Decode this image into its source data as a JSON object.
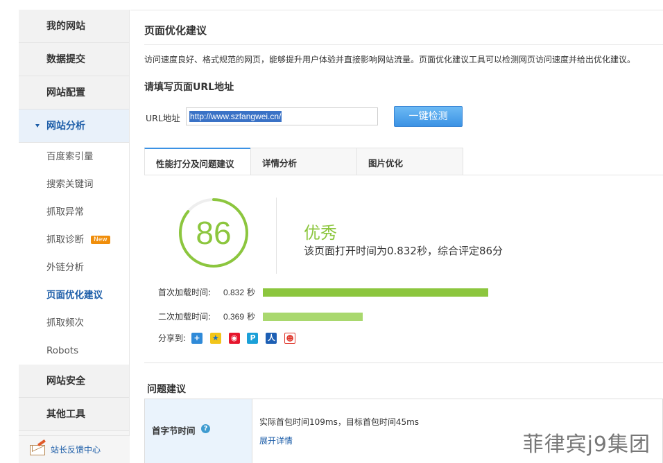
{
  "sidebar": {
    "sections": [
      {
        "label": "我的网站"
      },
      {
        "label": "数据提交"
      },
      {
        "label": "网站配置"
      },
      {
        "label": "网站分析"
      },
      {
        "label": "网站安全"
      },
      {
        "label": "其他工具"
      }
    ],
    "sub_items": [
      {
        "label": "百度索引量"
      },
      {
        "label": "搜索关键词"
      },
      {
        "label": "抓取异常"
      },
      {
        "label": "抓取诊断",
        "badge": "New"
      },
      {
        "label": "外链分析"
      },
      {
        "label": "页面优化建议"
      },
      {
        "label": "抓取频次"
      },
      {
        "label": "Robots"
      }
    ],
    "feedback_label": "站长反馈中心"
  },
  "main": {
    "title": "页面优化建议",
    "description": "访问速度良好、格式规范的网页，能够提升用户体验并直接影响网站流量。页面优化建议工具可以检测网页访问速度并给出优化建议。",
    "url_heading": "请填写页面URL地址",
    "url_label": "URL地址",
    "url_value": "http://www.szfangwei.cn/",
    "check_button": "一键检测",
    "tabs": [
      {
        "label": "性能打分及问题建议"
      },
      {
        "label": "详情分析"
      },
      {
        "label": "图片优化"
      }
    ],
    "score": {
      "value": "86",
      "fraction": 0.86,
      "grade": "优秀",
      "summary": "该页面打开时间为0.832秒，综合评定86分"
    },
    "loads": [
      {
        "label": "首次加载时间:",
        "value": "0.832",
        "unit": "秒"
      },
      {
        "label": "二次加载时间:",
        "value": "0.369",
        "unit": "秒"
      }
    ],
    "share_label": "分享到:",
    "share_icons": [
      "qzone-plus-icon",
      "qq-star-icon",
      "weibo-icon",
      "tencent-weibo-icon",
      "renren-icon",
      "kaixin-icon"
    ],
    "issues_title": "问题建议",
    "issues": [
      {
        "name": "首字节时间",
        "text": "实际首包时间109ms，目标首包时间45ms",
        "link": "展开详情"
      }
    ]
  },
  "watermark": "菲律宾j9集团",
  "colors": {
    "accent": "#1c5da8",
    "score_green": "#8cc63e",
    "button_blue": "#3b92e4"
  }
}
